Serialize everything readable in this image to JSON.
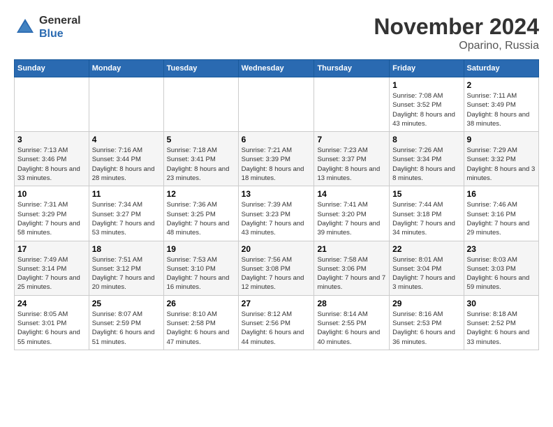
{
  "logo": {
    "general": "General",
    "blue": "Blue"
  },
  "title": "November 2024",
  "location": "Oparino, Russia",
  "weekdays": [
    "Sunday",
    "Monday",
    "Tuesday",
    "Wednesday",
    "Thursday",
    "Friday",
    "Saturday"
  ],
  "weeks": [
    [
      {
        "day": "",
        "info": ""
      },
      {
        "day": "",
        "info": ""
      },
      {
        "day": "",
        "info": ""
      },
      {
        "day": "",
        "info": ""
      },
      {
        "day": "",
        "info": ""
      },
      {
        "day": "1",
        "info": "Sunrise: 7:08 AM\nSunset: 3:52 PM\nDaylight: 8 hours and 43 minutes."
      },
      {
        "day": "2",
        "info": "Sunrise: 7:11 AM\nSunset: 3:49 PM\nDaylight: 8 hours and 38 minutes."
      }
    ],
    [
      {
        "day": "3",
        "info": "Sunrise: 7:13 AM\nSunset: 3:46 PM\nDaylight: 8 hours and 33 minutes."
      },
      {
        "day": "4",
        "info": "Sunrise: 7:16 AM\nSunset: 3:44 PM\nDaylight: 8 hours and 28 minutes."
      },
      {
        "day": "5",
        "info": "Sunrise: 7:18 AM\nSunset: 3:41 PM\nDaylight: 8 hours and 23 minutes."
      },
      {
        "day": "6",
        "info": "Sunrise: 7:21 AM\nSunset: 3:39 PM\nDaylight: 8 hours and 18 minutes."
      },
      {
        "day": "7",
        "info": "Sunrise: 7:23 AM\nSunset: 3:37 PM\nDaylight: 8 hours and 13 minutes."
      },
      {
        "day": "8",
        "info": "Sunrise: 7:26 AM\nSunset: 3:34 PM\nDaylight: 8 hours and 8 minutes."
      },
      {
        "day": "9",
        "info": "Sunrise: 7:29 AM\nSunset: 3:32 PM\nDaylight: 8 hours and 3 minutes."
      }
    ],
    [
      {
        "day": "10",
        "info": "Sunrise: 7:31 AM\nSunset: 3:29 PM\nDaylight: 7 hours and 58 minutes."
      },
      {
        "day": "11",
        "info": "Sunrise: 7:34 AM\nSunset: 3:27 PM\nDaylight: 7 hours and 53 minutes."
      },
      {
        "day": "12",
        "info": "Sunrise: 7:36 AM\nSunset: 3:25 PM\nDaylight: 7 hours and 48 minutes."
      },
      {
        "day": "13",
        "info": "Sunrise: 7:39 AM\nSunset: 3:23 PM\nDaylight: 7 hours and 43 minutes."
      },
      {
        "day": "14",
        "info": "Sunrise: 7:41 AM\nSunset: 3:20 PM\nDaylight: 7 hours and 39 minutes."
      },
      {
        "day": "15",
        "info": "Sunrise: 7:44 AM\nSunset: 3:18 PM\nDaylight: 7 hours and 34 minutes."
      },
      {
        "day": "16",
        "info": "Sunrise: 7:46 AM\nSunset: 3:16 PM\nDaylight: 7 hours and 29 minutes."
      }
    ],
    [
      {
        "day": "17",
        "info": "Sunrise: 7:49 AM\nSunset: 3:14 PM\nDaylight: 7 hours and 25 minutes."
      },
      {
        "day": "18",
        "info": "Sunrise: 7:51 AM\nSunset: 3:12 PM\nDaylight: 7 hours and 20 minutes."
      },
      {
        "day": "19",
        "info": "Sunrise: 7:53 AM\nSunset: 3:10 PM\nDaylight: 7 hours and 16 minutes."
      },
      {
        "day": "20",
        "info": "Sunrise: 7:56 AM\nSunset: 3:08 PM\nDaylight: 7 hours and 12 minutes."
      },
      {
        "day": "21",
        "info": "Sunrise: 7:58 AM\nSunset: 3:06 PM\nDaylight: 7 hours and 7 minutes."
      },
      {
        "day": "22",
        "info": "Sunrise: 8:01 AM\nSunset: 3:04 PM\nDaylight: 7 hours and 3 minutes."
      },
      {
        "day": "23",
        "info": "Sunrise: 8:03 AM\nSunset: 3:03 PM\nDaylight: 6 hours and 59 minutes."
      }
    ],
    [
      {
        "day": "24",
        "info": "Sunrise: 8:05 AM\nSunset: 3:01 PM\nDaylight: 6 hours and 55 minutes."
      },
      {
        "day": "25",
        "info": "Sunrise: 8:07 AM\nSunset: 2:59 PM\nDaylight: 6 hours and 51 minutes."
      },
      {
        "day": "26",
        "info": "Sunrise: 8:10 AM\nSunset: 2:58 PM\nDaylight: 6 hours and 47 minutes."
      },
      {
        "day": "27",
        "info": "Sunrise: 8:12 AM\nSunset: 2:56 PM\nDaylight: 6 hours and 44 minutes."
      },
      {
        "day": "28",
        "info": "Sunrise: 8:14 AM\nSunset: 2:55 PM\nDaylight: 6 hours and 40 minutes."
      },
      {
        "day": "29",
        "info": "Sunrise: 8:16 AM\nSunset: 2:53 PM\nDaylight: 6 hours and 36 minutes."
      },
      {
        "day": "30",
        "info": "Sunrise: 8:18 AM\nSunset: 2:52 PM\nDaylight: 6 hours and 33 minutes."
      }
    ]
  ]
}
